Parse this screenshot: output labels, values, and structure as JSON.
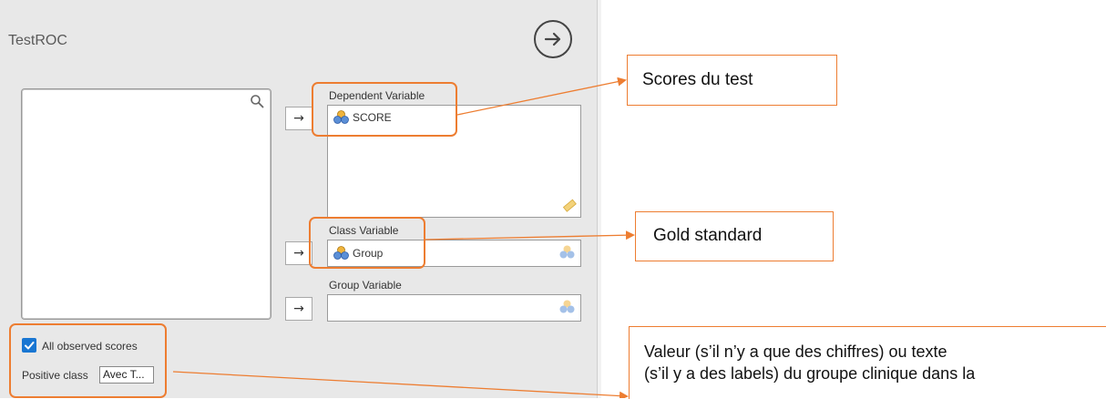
{
  "panel": {
    "title": "TestROC",
    "variables": {
      "dependent_label": "Dependent Variable",
      "dependent_value": "SCORE",
      "class_label": "Class Variable",
      "class_value": "Group",
      "group_label": "Group Variable",
      "group_value": ""
    },
    "arrow_glyph": "→",
    "options": {
      "all_observed_label": "All observed scores",
      "all_observed_checked": true,
      "positive_class_label": "Positive class",
      "positive_class_value": "Avec T..."
    }
  },
  "annotations": {
    "color": "#ed7d31",
    "callout_scores": "Scores du test",
    "callout_gold": "Gold standard",
    "callout_value_line1": "Valeur (s’il n’y a que des chiffres) ou texte",
    "callout_value_line2": "(s’il y a des labels) du groupe clinique dans la"
  },
  "icons": {
    "run": "arrow-circle-right-icon",
    "search": "search-icon",
    "variable": "nominal-variable-icon",
    "continuous": "ruler-icon",
    "check": "check-icon"
  }
}
